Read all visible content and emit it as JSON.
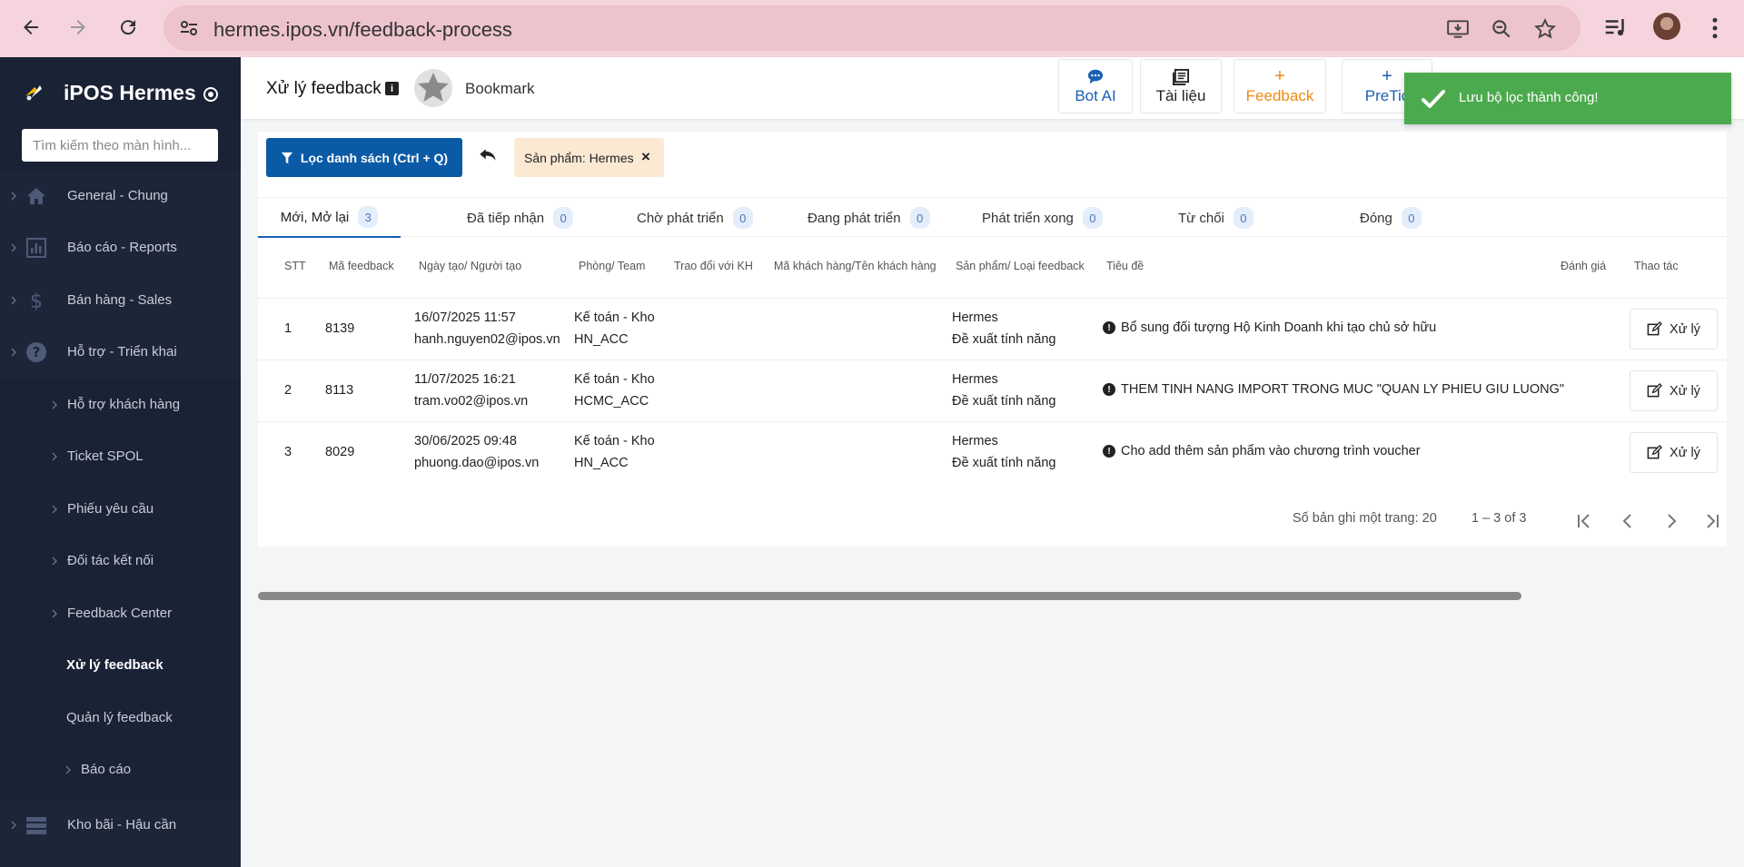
{
  "browser": {
    "url": "hermes.ipos.vn/feedback-process"
  },
  "sidebar": {
    "brand": "iPOS Hermes",
    "search_placeholder": "Tìm kiếm theo màn hình...",
    "items": [
      {
        "label": "General - Chung",
        "icon": "home-icon"
      },
      {
        "label": "Báo cáo - Reports",
        "icon": "bar-chart-icon"
      },
      {
        "label": "Bán hàng - Sales",
        "icon": "dollar-icon"
      },
      {
        "label": "Hỗ trợ - Triển khai",
        "icon": "help-circle-icon"
      },
      {
        "label": "Hỗ trợ khách hàng"
      },
      {
        "label": "Ticket SPOL"
      },
      {
        "label": "Phiếu yêu cầu"
      },
      {
        "label": "Đối tác kết nối"
      },
      {
        "label": "Feedback Center"
      },
      {
        "label": "Xử lý feedback"
      },
      {
        "label": "Quản lý feedback"
      },
      {
        "label": "Báo cáo"
      },
      {
        "label": "Kho bãi - Hậu cần",
        "icon": "server-icon"
      }
    ]
  },
  "header": {
    "title": "Xử lý feedback",
    "bookmark_label": "Bookmark",
    "tools": [
      {
        "label": "Bot AI",
        "icon": "chat-icon"
      },
      {
        "label": "Tài liệu",
        "icon": "book-icon"
      },
      {
        "label": "Feedback",
        "icon": "plus-icon"
      },
      {
        "label": "PreTic",
        "icon": "plus-icon"
      }
    ]
  },
  "toast": {
    "message": "Lưu bộ lọc thành công!"
  },
  "filter": {
    "button_label": "Lọc danh sách (Ctrl + Q)",
    "chip_label": "Sản phẩm: Hermes",
    "chip_close": "×"
  },
  "tabs": [
    {
      "label": "Mới, Mở lại",
      "count": "3"
    },
    {
      "label": "Đã tiếp nhận",
      "count": "0"
    },
    {
      "label": "Chờ phát triển",
      "count": "0"
    },
    {
      "label": "Đang phát triển",
      "count": "0"
    },
    {
      "label": "Phát triển xong",
      "count": "0"
    },
    {
      "label": "Từ chối",
      "count": "0"
    },
    {
      "label": "Đóng",
      "count": "0"
    }
  ],
  "table": {
    "columns": [
      "STT",
      "Mã feedback",
      "Ngày tạo/ Người tạo",
      "Phòng/ Team",
      "Trao đổi với KH",
      "Mã khách hàng/Tên khách hàng",
      "Sản phẩm/ Loại feedback",
      "Tiêu đề",
      "Đánh giá",
      "Thao tác"
    ],
    "action_label": "Xử lý",
    "rows": [
      {
        "stt": "1",
        "code": "8139",
        "date": "16/07/2025 11:57",
        "user": "hanh.nguyen02@ipos.vn",
        "dept": "Kế toán - Kho",
        "team": "HN_ACC",
        "product": "Hermes",
        "type": "Đề xuất tính năng",
        "title": "Bổ sung đối tượng Hộ Kinh Doanh khi tạo chủ sở hữu"
      },
      {
        "stt": "2",
        "code": "8113",
        "date": "11/07/2025 16:21",
        "user": "tram.vo02@ipos.vn",
        "dept": "Kế toán - Kho",
        "team": "HCMC_ACC",
        "product": "Hermes",
        "type": "Đề xuất tính năng",
        "title": "THEM TINH NANG IMPORT TRONG MUC \"QUAN LY PHIEU GIU LUONG\""
      },
      {
        "stt": "3",
        "code": "8029",
        "date": "30/06/2025 09:48",
        "user": "phuong.dao@ipos.vn",
        "dept": "Kế toán - Kho",
        "team": "HN_ACC",
        "product": "Hermes",
        "type": "Đề xuất tính năng",
        "title": "Cho add thêm sản phẩm vào chương trình voucher"
      }
    ]
  },
  "pager": {
    "page_size_label": "Số bản ghi một trang: 20",
    "range_label": "1 – 3 of 3"
  }
}
